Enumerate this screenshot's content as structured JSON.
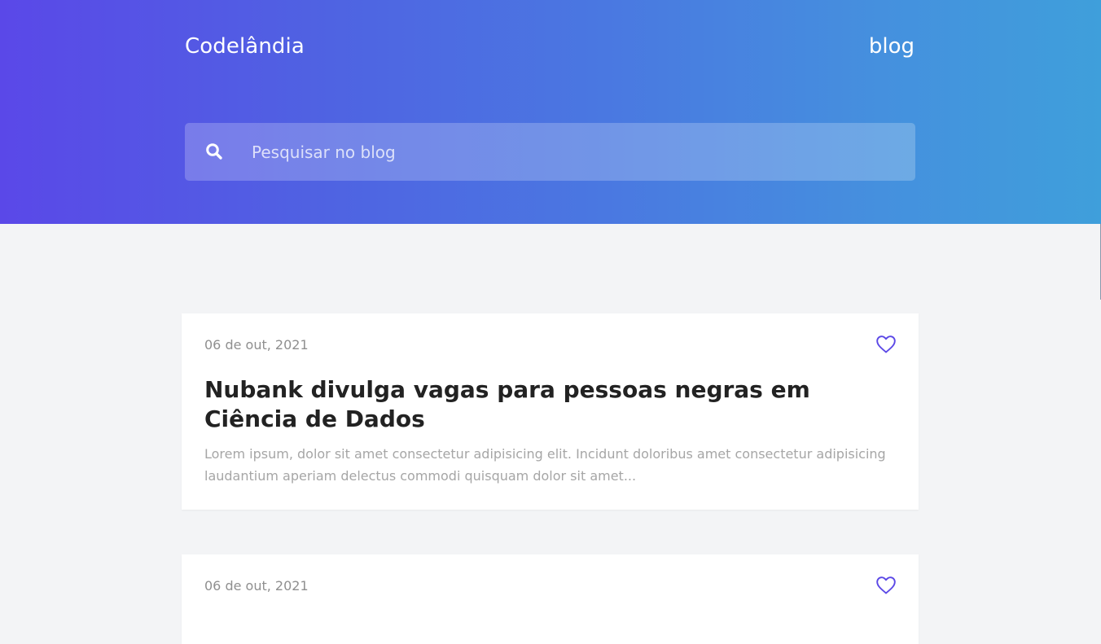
{
  "header": {
    "brand": "Codelândia",
    "nav_link": "blog"
  },
  "search": {
    "placeholder": "Pesquisar no blog",
    "icon": "search-icon"
  },
  "posts": [
    {
      "date": "06 de out, 2021",
      "title": "Nubank divulga vagas para pessoas negras em Ciência de Dados",
      "excerpt": "Lorem ipsum, dolor sit amet consectetur adipisicing elit. Incidunt doloribus amet consectetur adipisicing laudantium aperiam delectus commodi quisquam dolor sit amet...",
      "like_icon": "heart-icon"
    },
    {
      "date": "06 de out, 2021",
      "like_icon": "heart-icon"
    }
  ],
  "colors": {
    "accent": "#5b48e6",
    "header_start": "#5a48e8",
    "header_end": "#3f9fdb",
    "background": "#f3f4f6"
  }
}
